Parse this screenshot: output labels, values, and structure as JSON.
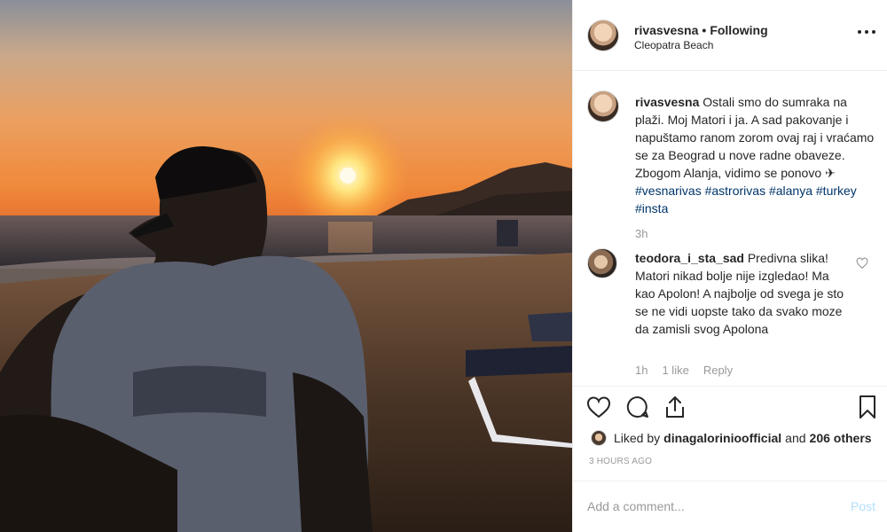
{
  "post": {
    "username": "rivasvesna",
    "follow_status": "Following",
    "separator": "•",
    "location": "Cleopatra Beach"
  },
  "caption": {
    "username": "rivasvesna",
    "text": "Ostali smo do sumraka na plaži. Moj Matori i ja. A sad pakovanje i napuštamo ranom zorom ovaj raj i vraćamo se za Beograd u nove radne obaveze. Zbogom Alanja, vidimo se ponovo ✈ ",
    "hashtags": [
      "#vesnarivas",
      "#astrorivas",
      "#alanya",
      "#turkey",
      "#insta"
    ],
    "time": "3h"
  },
  "comment": {
    "username": "teodora_i_sta_sad",
    "text": "Predivna slika! Matori nikad bolje nije izgledao! Ma kao Apolon! A najbolje od svega je sto se ne vidi uopste tako da svako moze da zamisli svog Apolona",
    "time": "1h",
    "likes": "1 like",
    "reply": "Reply"
  },
  "likes": {
    "prefix": "Liked by",
    "user": "dinagalorinioofficial",
    "connector": "and",
    "others": "206 others"
  },
  "posted_time": "3 HOURS AGO",
  "add_comment": {
    "placeholder": "Add a comment...",
    "post_label": "Post"
  },
  "colors": {
    "link": "#003569",
    "muted": "#999999",
    "post_button": "#b2dffc"
  }
}
